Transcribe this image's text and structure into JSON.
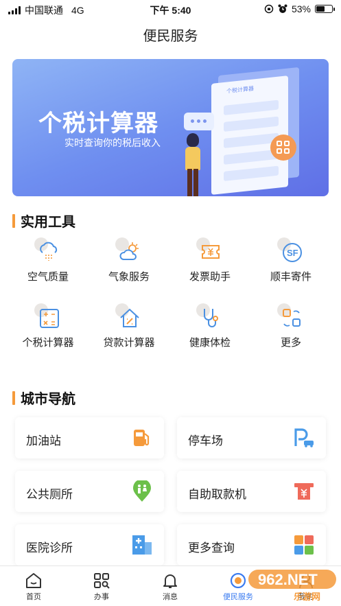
{
  "status_bar": {
    "carrier": "中国联通",
    "network": "4G",
    "time": "下午 5:40",
    "battery_percent": "53%",
    "battery_level": 0.53
  },
  "header": {
    "title": "便民服务"
  },
  "banner": {
    "title": "个税计算器",
    "subtitle": "实时查询你的税后收入",
    "doc_title": "个税计算器"
  },
  "tools": {
    "heading": "实用工具",
    "items": [
      {
        "label": "空气质量",
        "icon": "air-quality-icon"
      },
      {
        "label": "气象服务",
        "icon": "weather-icon"
      },
      {
        "label": "发票助手",
        "icon": "invoice-icon"
      },
      {
        "label": "顺丰寄件",
        "icon": "sf-express-icon"
      },
      {
        "label": "个税计算器",
        "icon": "calculator-icon"
      },
      {
        "label": "贷款计算器",
        "icon": "loan-calculator-icon"
      },
      {
        "label": "健康体检",
        "icon": "stethoscope-icon"
      },
      {
        "label": "更多",
        "icon": "more-grid-icon"
      }
    ]
  },
  "city_nav": {
    "heading": "城市导航",
    "items": [
      {
        "label": "加油站",
        "icon": "gas-station-icon",
        "color": "#f59a3b"
      },
      {
        "label": "停车场",
        "icon": "parking-icon",
        "color": "#4a9be8"
      },
      {
        "label": "公共厕所",
        "icon": "restroom-icon",
        "color": "#6cc04a"
      },
      {
        "label": "自助取款机",
        "icon": "atm-icon",
        "color": "#ef6a5a"
      },
      {
        "label": "医院诊所",
        "icon": "hospital-icon",
        "color": "#4a9be8"
      },
      {
        "label": "更多查询",
        "icon": "more-query-icon",
        "color": "#f59a3b"
      }
    ]
  },
  "tab_bar": {
    "items": [
      {
        "label": "首页",
        "icon": "home-icon"
      },
      {
        "label": "办事",
        "icon": "grid-search-icon"
      },
      {
        "label": "消息",
        "icon": "bell-icon"
      },
      {
        "label": "便民服务",
        "icon": "service-icon",
        "active": true
      },
      {
        "label": "我的",
        "icon": "profile-icon"
      }
    ]
  },
  "watermark": {
    "text": "962.NET",
    "subtext": "乐游网"
  },
  "colors": {
    "accent": "#f59a3b",
    "active_tab": "#3a7bf0",
    "icon_blue": "#4a90e2"
  }
}
